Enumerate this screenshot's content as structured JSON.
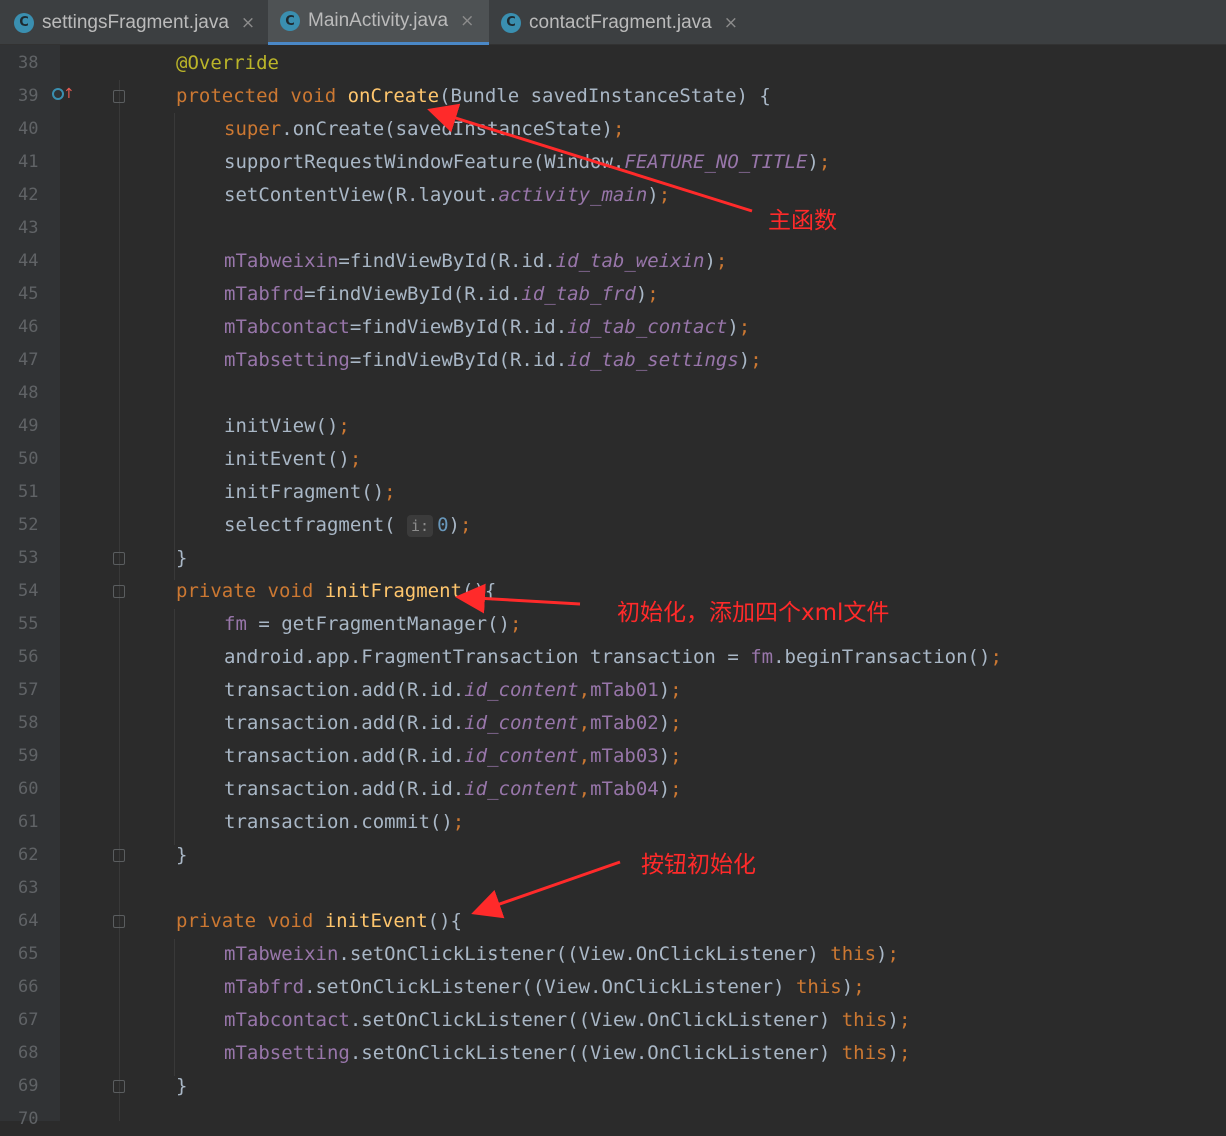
{
  "tabs": [
    {
      "label": "settingsFragment.java",
      "icon": "class-icon",
      "close": "×"
    },
    {
      "label": "MainActivity.java",
      "icon": "class-icon",
      "close": "×",
      "active": true
    },
    {
      "label": "contactFragment.java",
      "icon": "class-icon",
      "close": "×"
    }
  ],
  "class_icon_glyph": "C",
  "lines": [
    {
      "n": "38",
      "segs": [
        [
          "ann",
          "@Override"
        ]
      ]
    },
    {
      "n": "39",
      "segs": [
        [
          "kw",
          "protected void "
        ],
        [
          "fn",
          "onCreate"
        ],
        [
          "",
          "(Bundle savedInstanceState) {"
        ]
      ]
    },
    {
      "n": "40",
      "segs": [
        [
          "kw",
          "super"
        ],
        [
          "",
          ".onCreate(savedInstanceState)"
        ],
        [
          "kw",
          ";"
        ]
      ]
    },
    {
      "n": "41",
      "segs": [
        [
          "",
          "supportRequestWindowFeature(Window."
        ],
        [
          "ifld",
          "FEATURE_NO_TITLE"
        ],
        [
          "",
          ")"
        ],
        [
          "kw",
          ";"
        ]
      ]
    },
    {
      "n": "42",
      "segs": [
        [
          "",
          "setContentView(R.layout."
        ],
        [
          "ifld",
          "activity_main"
        ],
        [
          "",
          ")"
        ],
        [
          "kw",
          ";"
        ]
      ]
    },
    {
      "n": "43",
      "segs": []
    },
    {
      "n": "44",
      "segs": [
        [
          "fld",
          "mTabweixin"
        ],
        [
          "",
          "=findViewById(R.id."
        ],
        [
          "ifld",
          "id_tab_weixin"
        ],
        [
          "",
          ")"
        ],
        [
          "kw",
          ";"
        ]
      ]
    },
    {
      "n": "45",
      "segs": [
        [
          "fld",
          "mTabfrd"
        ],
        [
          "",
          "=findViewById(R.id."
        ],
        [
          "ifld",
          "id_tab_frd"
        ],
        [
          "",
          ")"
        ],
        [
          "kw",
          ";"
        ]
      ]
    },
    {
      "n": "46",
      "segs": [
        [
          "fld",
          "mTabcontact"
        ],
        [
          "",
          "=findViewById(R.id."
        ],
        [
          "ifld",
          "id_tab_contact"
        ],
        [
          "",
          ")"
        ],
        [
          "kw",
          ";"
        ]
      ]
    },
    {
      "n": "47",
      "segs": [
        [
          "fld",
          "mTabsetting"
        ],
        [
          "",
          "=findViewById(R.id."
        ],
        [
          "ifld",
          "id_tab_settings"
        ],
        [
          "",
          ")"
        ],
        [
          "kw",
          ";"
        ]
      ]
    },
    {
      "n": "48",
      "segs": []
    },
    {
      "n": "49",
      "segs": [
        [
          "",
          "initView()"
        ],
        [
          "kw",
          ";"
        ]
      ]
    },
    {
      "n": "50",
      "segs": [
        [
          "",
          "initEvent()"
        ],
        [
          "kw",
          ";"
        ]
      ]
    },
    {
      "n": "51",
      "segs": [
        [
          "",
          "initFragment()"
        ],
        [
          "kw",
          ";"
        ]
      ]
    },
    {
      "n": "52",
      "segs": [
        [
          "",
          "selectfragment( "
        ],
        [
          "hint",
          "i:"
        ],
        [
          "num",
          "0"
        ],
        [
          "",
          ")"
        ],
        [
          "kw",
          ";"
        ]
      ]
    },
    {
      "n": "53",
      "segs": [
        [
          "",
          "}"
        ]
      ]
    },
    {
      "n": "54",
      "segs": [
        [
          "kw",
          "private void "
        ],
        [
          "fn",
          "initFragment"
        ],
        [
          "",
          "(){"
        ]
      ]
    },
    {
      "n": "55",
      "segs": [
        [
          "fld",
          "fm"
        ],
        [
          "",
          " = getFragmentManager()"
        ],
        [
          "kw",
          ";"
        ]
      ]
    },
    {
      "n": "56",
      "segs": [
        [
          "",
          "android.app.FragmentTransaction transaction = "
        ],
        [
          "fld",
          "fm"
        ],
        [
          "",
          ".beginTransaction()"
        ],
        [
          "kw",
          ";"
        ]
      ]
    },
    {
      "n": "57",
      "segs": [
        [
          "",
          "transaction.add(R.id."
        ],
        [
          "ifld",
          "id_content"
        ],
        [
          "kw",
          ","
        ],
        [
          "fld",
          "mTab01"
        ],
        [
          "",
          ")"
        ],
        [
          "kw",
          ";"
        ]
      ]
    },
    {
      "n": "58",
      "segs": [
        [
          "",
          "transaction.add(R.id."
        ],
        [
          "ifld",
          "id_content"
        ],
        [
          "kw",
          ","
        ],
        [
          "fld",
          "mTab02"
        ],
        [
          "",
          ")"
        ],
        [
          "kw",
          ";"
        ]
      ]
    },
    {
      "n": "59",
      "segs": [
        [
          "",
          "transaction.add(R.id."
        ],
        [
          "ifld",
          "id_content"
        ],
        [
          "kw",
          ","
        ],
        [
          "fld",
          "mTab03"
        ],
        [
          "",
          ")"
        ],
        [
          "kw",
          ";"
        ]
      ]
    },
    {
      "n": "60",
      "segs": [
        [
          "",
          "transaction.add(R.id."
        ],
        [
          "ifld",
          "id_content"
        ],
        [
          "kw",
          ","
        ],
        [
          "fld",
          "mTab04"
        ],
        [
          "",
          ")"
        ],
        [
          "kw",
          ";"
        ]
      ]
    },
    {
      "n": "61",
      "segs": [
        [
          "",
          "transaction.commit()"
        ],
        [
          "kw",
          ";"
        ]
      ]
    },
    {
      "n": "62",
      "segs": [
        [
          "",
          "}"
        ]
      ]
    },
    {
      "n": "63",
      "segs": []
    },
    {
      "n": "64",
      "segs": [
        [
          "kw",
          "private void "
        ],
        [
          "fn",
          "initEvent"
        ],
        [
          "",
          "(){"
        ]
      ]
    },
    {
      "n": "65",
      "segs": [
        [
          "fld",
          "mTabweixin"
        ],
        [
          "",
          ".setOnClickListener((View.OnClickListener) "
        ],
        [
          "kw",
          "this"
        ],
        [
          "",
          ")"
        ],
        [
          "kw",
          ";"
        ]
      ]
    },
    {
      "n": "66",
      "segs": [
        [
          "fld",
          "mTabfrd"
        ],
        [
          "",
          ".setOnClickListener((View.OnClickListener) "
        ],
        [
          "kw",
          "this"
        ],
        [
          "",
          ")"
        ],
        [
          "kw",
          ";"
        ]
      ]
    },
    {
      "n": "67",
      "segs": [
        [
          "fld",
          "mTabcontact"
        ],
        [
          "",
          ".setOnClickListener((View.OnClickListener) "
        ],
        [
          "kw",
          "this"
        ],
        [
          "",
          ")"
        ],
        [
          "kw",
          ";"
        ]
      ]
    },
    {
      "n": "68",
      "segs": [
        [
          "fld",
          "mTabsetting"
        ],
        [
          "",
          ".setOnClickListener((View.OnClickListener) "
        ],
        [
          "kw",
          "this"
        ],
        [
          "",
          ")"
        ],
        [
          "kw",
          ";"
        ]
      ]
    },
    {
      "n": "69",
      "segs": [
        [
          "",
          "}"
        ]
      ]
    },
    {
      "n": "70",
      "segs": []
    }
  ],
  "annotations": [
    {
      "text": "主函数"
    },
    {
      "text": "初始化，添加四个xml文件"
    },
    {
      "text": "按钮初始化"
    }
  ],
  "colors": {
    "background": "#2b2b2b",
    "keyword": "#cc7832",
    "method": "#ffc66d",
    "field": "#9876aa",
    "annotation_text": "#ff2a2a",
    "active_tab_underline": "#4a88c7"
  }
}
